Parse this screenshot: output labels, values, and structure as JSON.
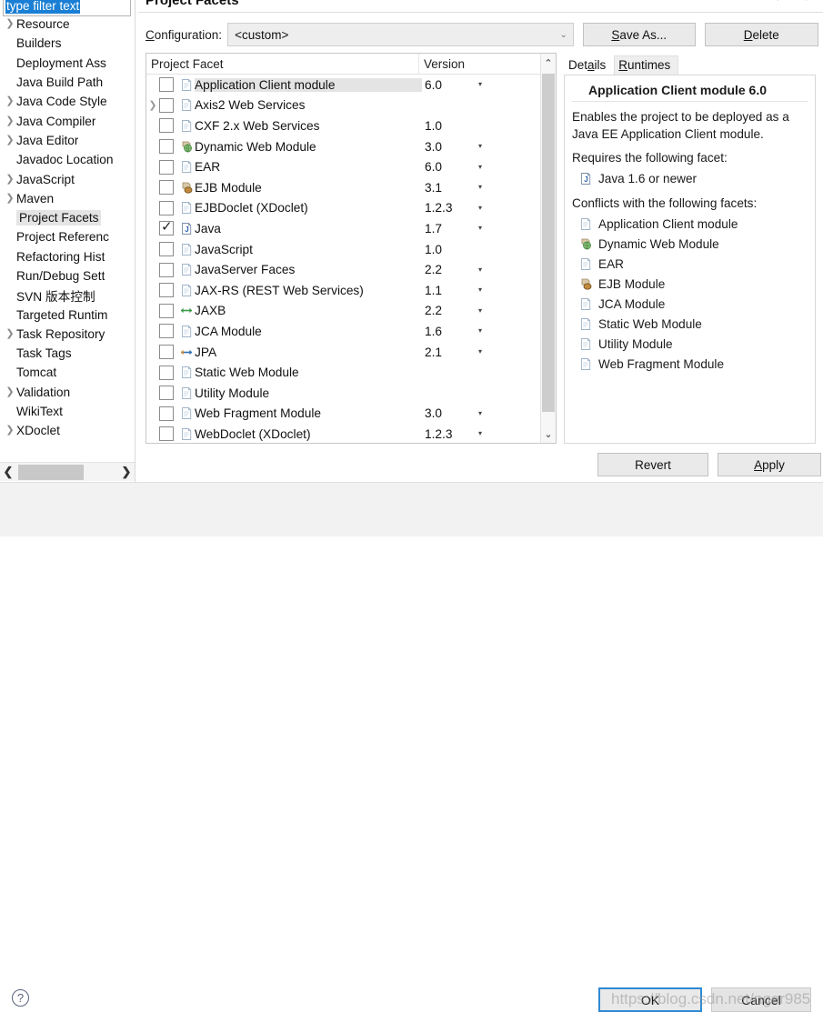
{
  "window": {
    "page_title": "Project Facets",
    "nav_arrows": "⇦ ⇨"
  },
  "sidebar": {
    "filter": {
      "value": "type filter text",
      "placeholder": "type filter text"
    },
    "items": [
      {
        "label": "Resource",
        "expandable": true,
        "selected": false
      },
      {
        "label": "Builders",
        "expandable": false,
        "selected": false
      },
      {
        "label": "Deployment Ass",
        "expandable": false,
        "selected": false
      },
      {
        "label": "Java Build Path",
        "expandable": false,
        "selected": false
      },
      {
        "label": "Java Code Style",
        "expandable": true,
        "selected": false
      },
      {
        "label": "Java Compiler",
        "expandable": true,
        "selected": false
      },
      {
        "label": "Java Editor",
        "expandable": true,
        "selected": false
      },
      {
        "label": "Javadoc Location",
        "expandable": false,
        "selected": false
      },
      {
        "label": "JavaScript",
        "expandable": true,
        "selected": false
      },
      {
        "label": "Maven",
        "expandable": true,
        "selected": false
      },
      {
        "label": "Project Facets",
        "expandable": false,
        "selected": true
      },
      {
        "label": "Project Referenc",
        "expandable": false,
        "selected": false
      },
      {
        "label": "Refactoring Hist",
        "expandable": false,
        "selected": false
      },
      {
        "label": "Run/Debug Sett",
        "expandable": false,
        "selected": false
      },
      {
        "label": "SVN 版本控制",
        "expandable": false,
        "selected": false
      },
      {
        "label": "Targeted Runtim",
        "expandable": false,
        "selected": false
      },
      {
        "label": "Task Repository",
        "expandable": true,
        "selected": false
      },
      {
        "label": "Task Tags",
        "expandable": false,
        "selected": false
      },
      {
        "label": "Tomcat",
        "expandable": false,
        "selected": false
      },
      {
        "label": "Validation",
        "expandable": true,
        "selected": false
      },
      {
        "label": "WikiText",
        "expandable": false,
        "selected": false
      },
      {
        "label": "XDoclet",
        "expandable": true,
        "selected": false
      }
    ],
    "hscroll": {
      "left_arrow": "❮",
      "right_arrow": "❯"
    }
  },
  "config": {
    "label_prefix": "C",
    "label_rest": "onfiguration:",
    "value": "<custom>",
    "chevron": "⌄",
    "save_as_prefix": "S",
    "save_as_rest": "ave As...",
    "delete_prefix": "D",
    "delete_rest": "elete"
  },
  "facet_table": {
    "columns": [
      "Project Facet",
      "Version"
    ],
    "rows": [
      {
        "name": "Application Client module",
        "version": "6.0",
        "checked": false,
        "expandable": false,
        "highlighted": true,
        "icon": "doc-icon",
        "has_dropdown": true
      },
      {
        "name": "Axis2 Web Services",
        "version": "",
        "checked": false,
        "expandable": true,
        "highlighted": false,
        "icon": "doc-icon",
        "has_dropdown": false
      },
      {
        "name": "CXF 2.x Web Services",
        "version": "1.0",
        "checked": false,
        "expandable": false,
        "highlighted": false,
        "icon": "doc-icon",
        "has_dropdown": false
      },
      {
        "name": "Dynamic Web Module",
        "version": "3.0",
        "checked": false,
        "expandable": false,
        "highlighted": false,
        "icon": "web-icon",
        "has_dropdown": true
      },
      {
        "name": "EAR",
        "version": "6.0",
        "checked": false,
        "expandable": false,
        "highlighted": false,
        "icon": "doc-icon",
        "has_dropdown": true
      },
      {
        "name": "EJB Module",
        "version": "3.1",
        "checked": false,
        "expandable": false,
        "highlighted": false,
        "icon": "ejb-icon",
        "has_dropdown": true
      },
      {
        "name": "EJBDoclet (XDoclet)",
        "version": "1.2.3",
        "checked": false,
        "expandable": false,
        "highlighted": false,
        "icon": "doc-icon",
        "has_dropdown": true
      },
      {
        "name": "Java",
        "version": "1.7",
        "checked": true,
        "expandable": false,
        "highlighted": false,
        "icon": "java-icon",
        "has_dropdown": true
      },
      {
        "name": "JavaScript",
        "version": "1.0",
        "checked": false,
        "expandable": false,
        "highlighted": false,
        "icon": "doc-icon",
        "has_dropdown": false
      },
      {
        "name": "JavaServer Faces",
        "version": "2.2",
        "checked": false,
        "expandable": false,
        "highlighted": false,
        "icon": "doc-icon",
        "has_dropdown": true
      },
      {
        "name": "JAX-RS (REST Web Services)",
        "version": "1.1",
        "checked": false,
        "expandable": false,
        "highlighted": false,
        "icon": "doc-icon",
        "has_dropdown": true
      },
      {
        "name": "JAXB",
        "version": "2.2",
        "checked": false,
        "expandable": false,
        "highlighted": false,
        "icon": "jaxb-icon",
        "has_dropdown": true
      },
      {
        "name": "JCA Module",
        "version": "1.6",
        "checked": false,
        "expandable": false,
        "highlighted": false,
        "icon": "doc-icon",
        "has_dropdown": true
      },
      {
        "name": "JPA",
        "version": "2.1",
        "checked": false,
        "expandable": false,
        "highlighted": false,
        "icon": "jpa-icon",
        "has_dropdown": true
      },
      {
        "name": "Static Web Module",
        "version": "",
        "checked": false,
        "expandable": false,
        "highlighted": false,
        "icon": "doc-icon",
        "has_dropdown": false
      },
      {
        "name": "Utility Module",
        "version": "",
        "checked": false,
        "expandable": false,
        "highlighted": false,
        "icon": "doc-icon",
        "has_dropdown": false
      },
      {
        "name": "Web Fragment Module",
        "version": "3.0",
        "checked": false,
        "expandable": false,
        "highlighted": false,
        "icon": "doc-icon",
        "has_dropdown": true
      },
      {
        "name": "WebDoclet (XDoclet)",
        "version": "1.2.3",
        "checked": false,
        "expandable": false,
        "highlighted": false,
        "icon": "doc-icon",
        "has_dropdown": true
      }
    ],
    "scrollbar": {
      "up": "⌃",
      "down": "⌄"
    }
  },
  "details": {
    "tabs": [
      {
        "label_prefix": "Det",
        "label_mid": "a",
        "label_rest": "ils",
        "active": true
      },
      {
        "label_prefix": "",
        "label_mid": "R",
        "label_rest": "untimes",
        "active": false
      }
    ],
    "tab_details": "Details",
    "tab_runtimes": "Runtimes",
    "title": "Application Client module 6.0",
    "description": "Enables the project to be deployed as a Java EE Application Client module.",
    "requires_heading": "Requires the following facet:",
    "requires": [
      {
        "label": "Java 1.6 or newer",
        "icon": "java-icon"
      }
    ],
    "conflicts_heading": "Conflicts with the following facets:",
    "conflicts": [
      {
        "label": "Application Client module",
        "icon": "doc-icon"
      },
      {
        "label": "Dynamic Web Module",
        "icon": "web-icon"
      },
      {
        "label": "EAR",
        "icon": "doc-icon"
      },
      {
        "label": "EJB Module",
        "icon": "ejb-icon"
      },
      {
        "label": "JCA Module",
        "icon": "doc-icon"
      },
      {
        "label": "Static Web Module",
        "icon": "doc-icon"
      },
      {
        "label": "Utility Module",
        "icon": "doc-icon"
      },
      {
        "label": "Web Fragment Module",
        "icon": "doc-icon"
      }
    ]
  },
  "actions": {
    "revert": "Revert",
    "apply_prefix": "A",
    "apply_rest": "pply",
    "ok": "OK",
    "cancel": "Cancel",
    "help": "?"
  },
  "watermark": "https://blog.csdn.net/nger985",
  "colors": {
    "selection_blue": "#1a7fd4",
    "row_highlight": "#e4e4e4",
    "ok_border": "#2e8ad4",
    "button_face": "#eaeaea",
    "panel_bg": "#f2f2f2"
  }
}
